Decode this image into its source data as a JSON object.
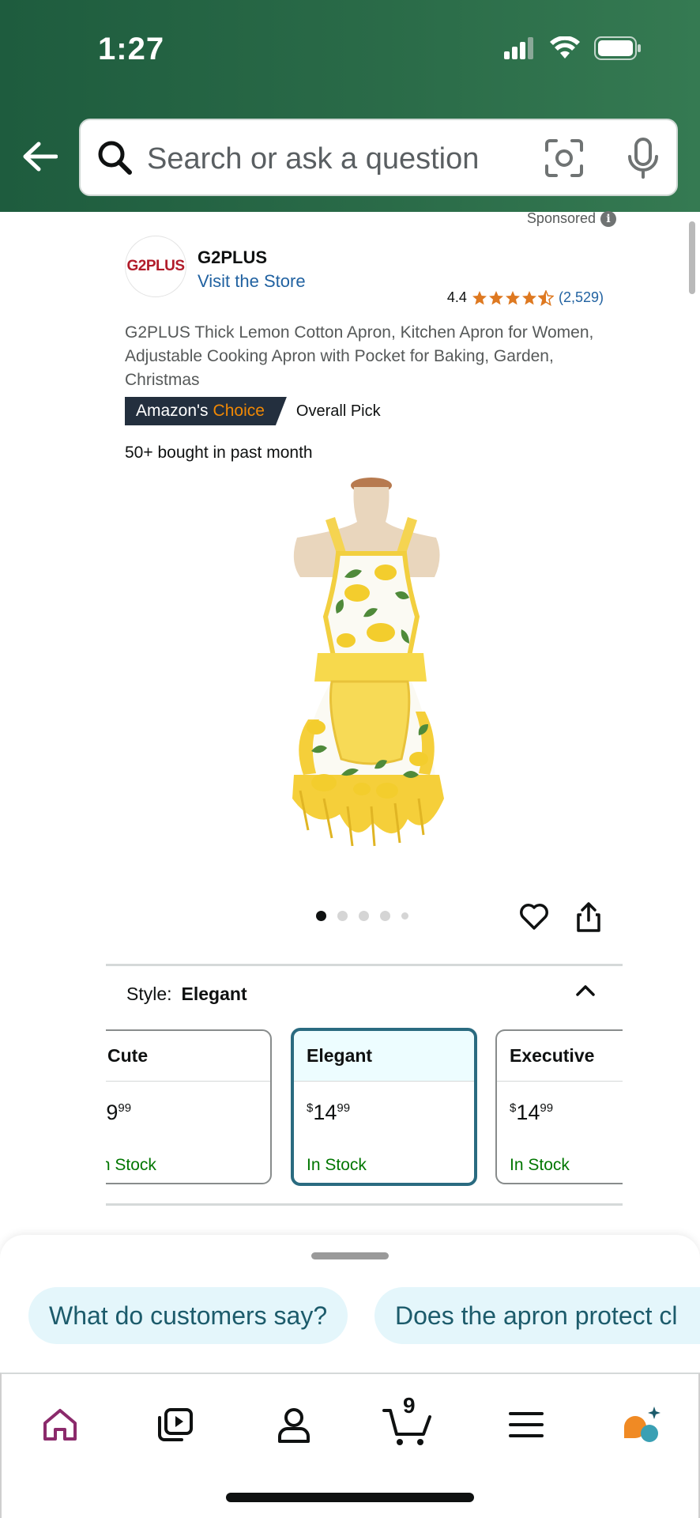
{
  "status_bar": {
    "time": "1:27"
  },
  "search": {
    "placeholder": "Search or ask a question"
  },
  "sponsored_label": "Sponsored",
  "brand": {
    "logo_text": "G2PLUS",
    "name": "G2PLUS",
    "visit_store": "Visit the Store"
  },
  "rating": {
    "value": "4.4",
    "stars": 4.5,
    "count": "(2,529)"
  },
  "product": {
    "title": "G2PLUS Thick Lemon Cotton Apron, Kitchen Apron for Women, Adjustable Cooking Apron with Pocket for Baking, Garden, Christmas",
    "badge_prefix": "Amazon's",
    "badge_accent": "Choice",
    "overall_pick": "Overall Pick",
    "bought": "50+ bought in past month"
  },
  "image_dots": {
    "count": 5,
    "active": 0
  },
  "style": {
    "label": "Style:",
    "selected": "Elegant",
    "options": [
      {
        "name": "Cute",
        "currency": "$",
        "price_whole": "9",
        "price_frac": "99",
        "stock": "In Stock"
      },
      {
        "name": "Elegant",
        "currency": "$",
        "price_whole": "14",
        "price_frac": "99",
        "stock": "In Stock"
      },
      {
        "name": "Executive",
        "currency": "$",
        "price_whole": "14",
        "price_frac": "99",
        "stock": "In Stock"
      }
    ]
  },
  "suggestions": [
    "What do customers say?",
    "Does the apron protect cl"
  ],
  "tabbar": {
    "items": [
      "home-icon",
      "video-icon",
      "account-icon",
      "cart-icon",
      "menu-icon",
      "rufus-icon"
    ],
    "cart_count": "9"
  },
  "colors": {
    "header_green": "#2a6b48",
    "link_blue": "#2162a1",
    "star_orange": "#de7921",
    "stock_green": "#007600",
    "selected_teal": "#2a6b80",
    "chip_bg": "#e4f6fb",
    "home_active": "#8b2a6b"
  }
}
